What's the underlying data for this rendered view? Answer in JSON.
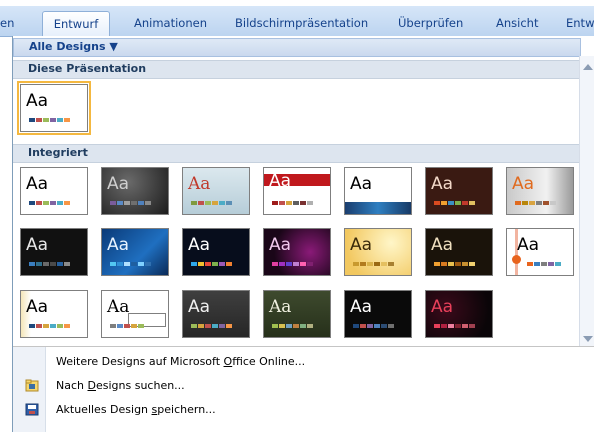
{
  "ribbon": {
    "tabs": [
      {
        "label": "en"
      },
      {
        "label": "Entwurf",
        "active": true
      },
      {
        "label": "Animationen"
      },
      {
        "label": "Bildschirmpräsentation"
      },
      {
        "label": "Überprüfen"
      },
      {
        "label": "Ansicht"
      },
      {
        "label": "Entw"
      }
    ]
  },
  "gallery": {
    "filter_label": "Alle Designs ▼",
    "section_current": "Diese Präsentation",
    "section_builtin": "Integriert",
    "thumb_text": "Aa"
  },
  "menu": {
    "online": {
      "before": "Weitere Designs auf Microsoft ",
      "underlined": "O",
      "after": "ffice Online..."
    },
    "browse": {
      "before": "Nach ",
      "underlined": "D",
      "after": "esigns suchen..."
    },
    "save": {
      "before": "Aktuelles Design ",
      "underlined": "s",
      "after": "peichern..."
    }
  },
  "colors": {
    "accent": "#15428b",
    "selection": "#f4b840"
  }
}
